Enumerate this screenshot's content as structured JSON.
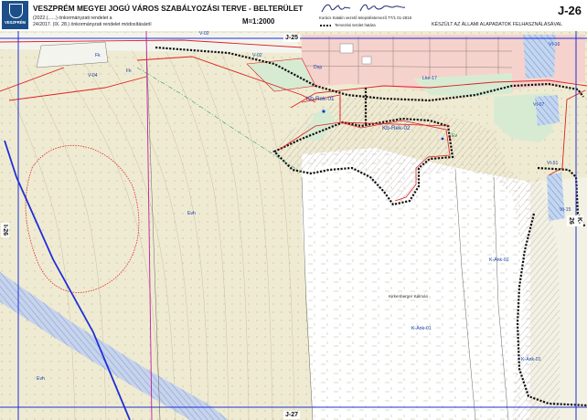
{
  "header": {
    "logo_text": "VESZPRÉM",
    "title": "VESZPRÉM MEGYEI JOGÚ VÁROS SZABÁLYOZÁSI TERVE  -  BELTERÜLET",
    "subtitle_1": "(2022.(......) önkormányzati rendelet a",
    "subtitle_2": "24/2017. (IX. 28.) önkormányzati rendelet módosításáról",
    "scale": "M=1:2000",
    "designer": "Korács Katalin vezető településtervező TT/1 01-2818",
    "legend_item": "Tervezési terület határa",
    "basemap_note": "KÉSZÜLT AZ ÁLLAMI ALAPADATOK FELHASZNÁLÁSÁVAL",
    "sheet": "J-26"
  },
  "map": {
    "sheet_labels": {
      "north": "J-25",
      "south": "J-27",
      "west": "I-26",
      "east": "K-26"
    },
    "zones": {
      "kb_rek_01": "Kb-Rek-01",
      "kb_rek_02": "Kb-Rek-02",
      "evh_1": "Evh",
      "evh_2": "Evh",
      "k_ank_01_a": "K-Ánk-01",
      "k_ank_01_b": "K-Ánk-01",
      "k_ank_01_c": "K-Ánk-01",
      "v_02_a": "V-02",
      "v_02_b": "V-02",
      "v_04": "V-04",
      "fk_a": "Fk",
      "fk_b": "Fk",
      "lke_17": "Lke-17",
      "vt_07": "Vt-07",
      "vt_15": "Vt-15",
      "vt_16": "Vt-16",
      "vt_51": "Vt-51",
      "dsp": "Dsp",
      "ev": "Ev"
    },
    "places": {
      "kirkenberger": "Kirkenberger Kálmán"
    },
    "colors": {
      "agricultural": "#efebd2",
      "forest": "#ffffff",
      "residential": "#f6d2cc",
      "water": "#c4d6ee",
      "green_area": "#d7ebd3",
      "regulation_line": "#e02020",
      "zone_label": "#1a3fa8",
      "road_axis": "#1f2fd6"
    }
  }
}
